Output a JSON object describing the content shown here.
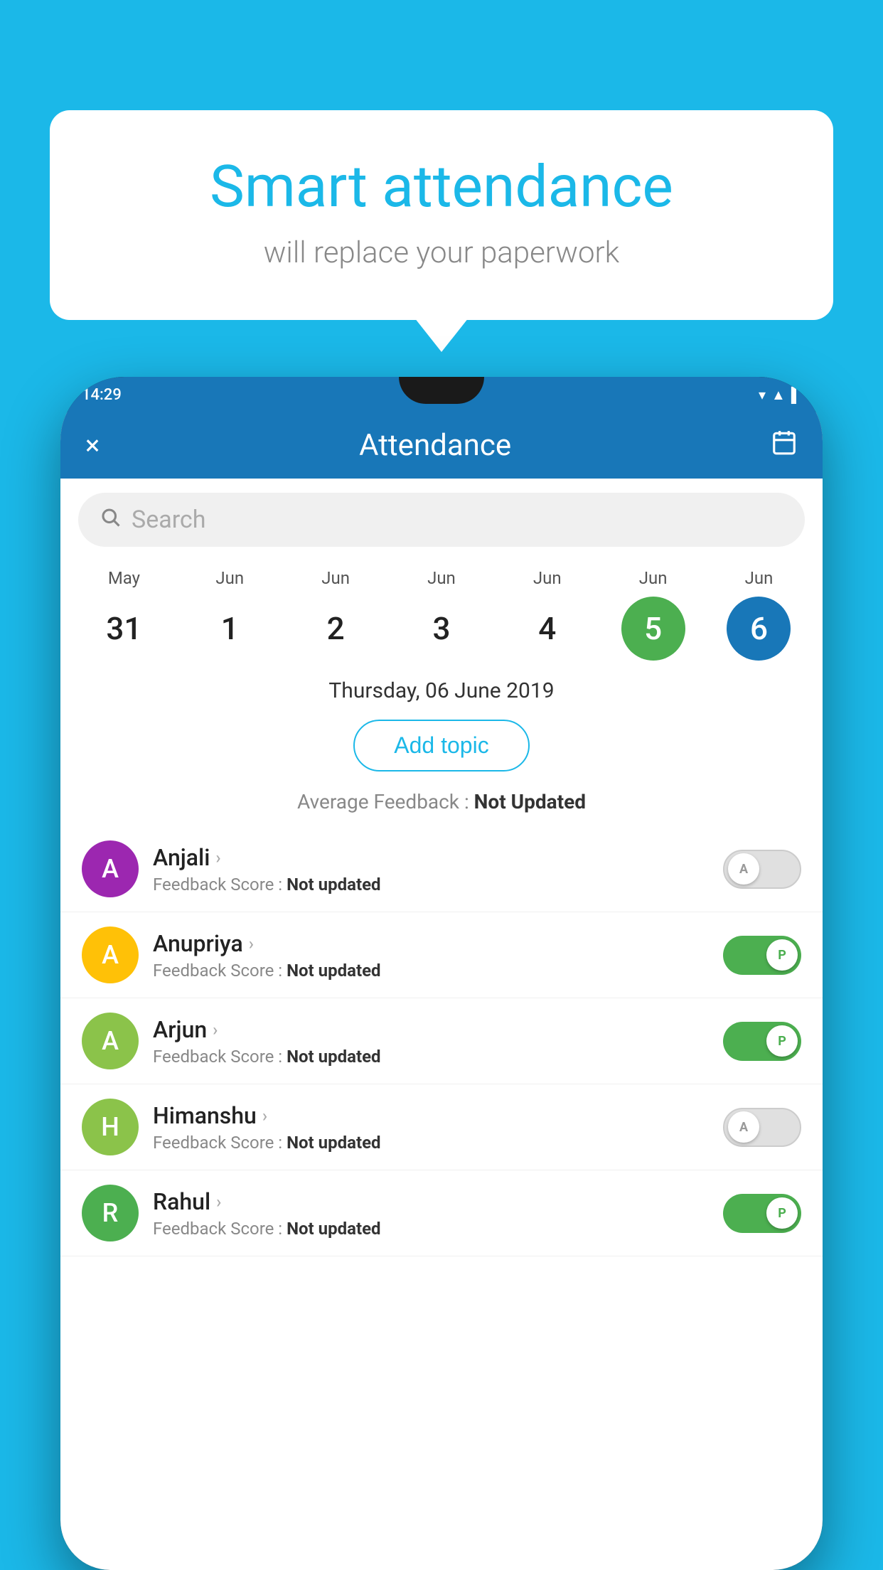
{
  "background_color": "#1BB8E8",
  "speech_bubble": {
    "title": "Smart attendance",
    "subtitle": "will replace your paperwork"
  },
  "phone": {
    "status_bar": {
      "time": "14:29",
      "icons": [
        "▼",
        "▲",
        "▌"
      ]
    },
    "header": {
      "close_label": "×",
      "title": "Attendance",
      "calendar_icon": "📅"
    },
    "search": {
      "placeholder": "Search"
    },
    "calendar": {
      "days": [
        {
          "month": "May",
          "date": "31",
          "highlight": "none"
        },
        {
          "month": "Jun",
          "date": "1",
          "highlight": "none"
        },
        {
          "month": "Jun",
          "date": "2",
          "highlight": "none"
        },
        {
          "month": "Jun",
          "date": "3",
          "highlight": "none"
        },
        {
          "month": "Jun",
          "date": "4",
          "highlight": "none"
        },
        {
          "month": "Jun",
          "date": "5",
          "highlight": "green"
        },
        {
          "month": "Jun",
          "date": "6",
          "highlight": "blue"
        }
      ]
    },
    "selected_date": "Thursday, 06 June 2019",
    "add_topic_label": "Add topic",
    "avg_feedback_label": "Average Feedback : ",
    "avg_feedback_value": "Not Updated",
    "students": [
      {
        "name": "Anjali",
        "avatar_letter": "A",
        "avatar_color": "#9C27B0",
        "score_label": "Feedback Score : ",
        "score_value": "Not updated",
        "toggle_state": "off",
        "toggle_label": "A"
      },
      {
        "name": "Anupriya",
        "avatar_letter": "A",
        "avatar_color": "#FFC107",
        "score_label": "Feedback Score : ",
        "score_value": "Not updated",
        "toggle_state": "on",
        "toggle_label": "P"
      },
      {
        "name": "Arjun",
        "avatar_letter": "A",
        "avatar_color": "#8BC34A",
        "score_label": "Feedback Score : ",
        "score_value": "Not updated",
        "toggle_state": "on",
        "toggle_label": "P"
      },
      {
        "name": "Himanshu",
        "avatar_letter": "H",
        "avatar_color": "#8BC34A",
        "score_label": "Feedback Score : ",
        "score_value": "Not updated",
        "toggle_state": "off",
        "toggle_label": "A"
      },
      {
        "name": "Rahul",
        "avatar_letter": "R",
        "avatar_color": "#4CAF50",
        "score_label": "Feedback Score : ",
        "score_value": "Not updated",
        "toggle_state": "on",
        "toggle_label": "P"
      }
    ]
  }
}
